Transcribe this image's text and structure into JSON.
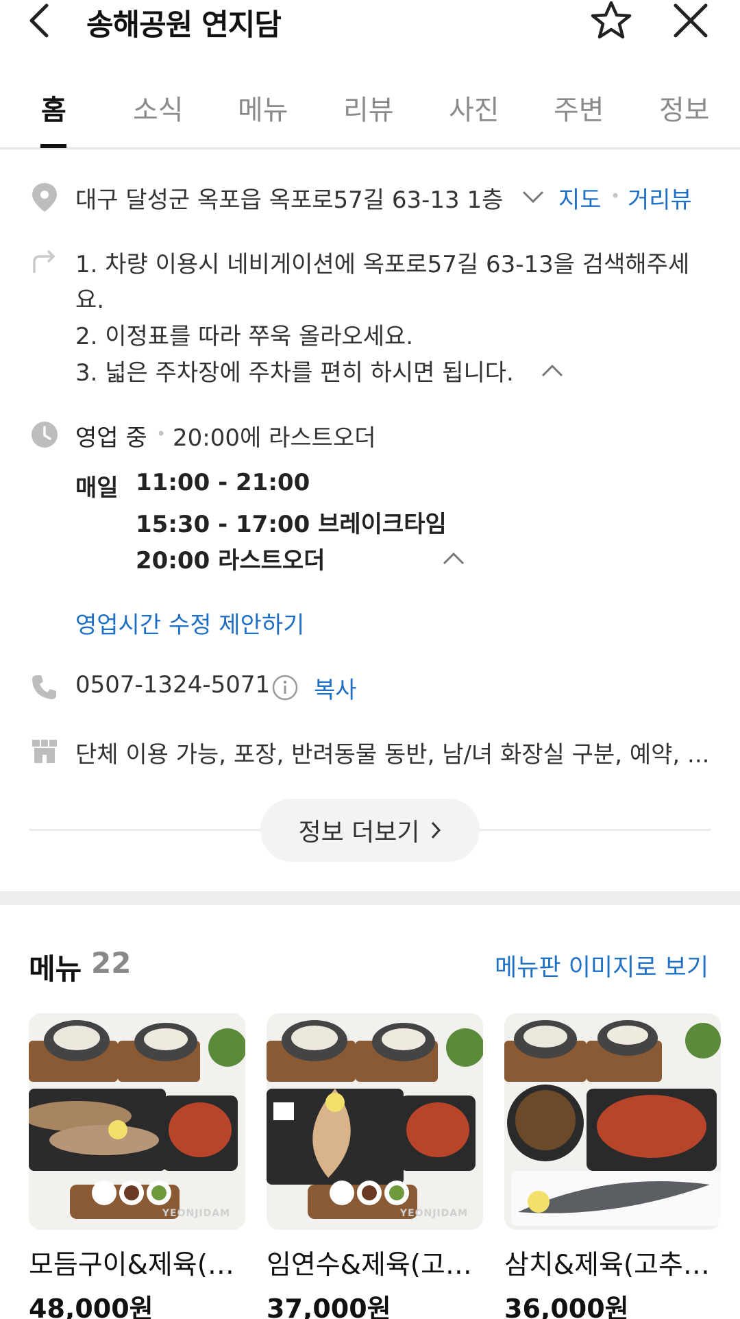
{
  "header": {
    "title": "송해공원 연지담"
  },
  "tabs": [
    {
      "label": "홈",
      "active": true
    },
    {
      "label": "소식",
      "active": false
    },
    {
      "label": "메뉴",
      "active": false
    },
    {
      "label": "리뷰",
      "active": false
    },
    {
      "label": "사진",
      "active": false
    },
    {
      "label": "주변",
      "active": false
    },
    {
      "label": "정보",
      "active": false
    }
  ],
  "address": {
    "text": "대구 달성군 옥포읍 옥포로57길 63-13 1층",
    "map_link": "지도",
    "roadview_link": "거리뷰"
  },
  "directions": {
    "line1": "1. 차량 이용시 네비게이션에 옥포로57길 63-13을 검색해주세",
    "line1b": "요.",
    "line2": "2. 이정표를 따라 쭈욱 올라오세요.",
    "line3": "3. 넓은 주차장에 주차를 편히 하시면 됩니다."
  },
  "hours": {
    "status": "영업 중",
    "last_order_summary": "20:00에 라스트오더",
    "day": "매일",
    "open": "11:00 - 21:00",
    "break": "15:30 - 17:00 브레이크타임",
    "last_order": "20:00 라스트오더",
    "suggest_edit": "영업시간 수정 제안하기"
  },
  "phone": {
    "number": "0507-1324-5071",
    "copy_label": "복사"
  },
  "amenities": {
    "text": "단체 이용 가능, 포장, 반려동물 동반, 남/녀 화장실 구분, 예약, ..."
  },
  "more_info_label": "정보 더보기",
  "menu": {
    "title": "메뉴",
    "count": "22",
    "board_link": "메뉴판 이미지로 보기",
    "items": [
      {
        "name": "모듬구이&제육(고...",
        "price": "48,000원",
        "watermark": "YEONJIDAM"
      },
      {
        "name": "임연수&제육(고추...",
        "price": "37,000원",
        "watermark": "YEONJIDAM"
      },
      {
        "name": "삼치&제육(고추장...",
        "price": "36,000원",
        "watermark": ""
      }
    ]
  },
  "colors": {
    "link_blue": "#1f6fc5",
    "icon_gray": "#bdbdbd",
    "separator": "#eeeeee"
  }
}
